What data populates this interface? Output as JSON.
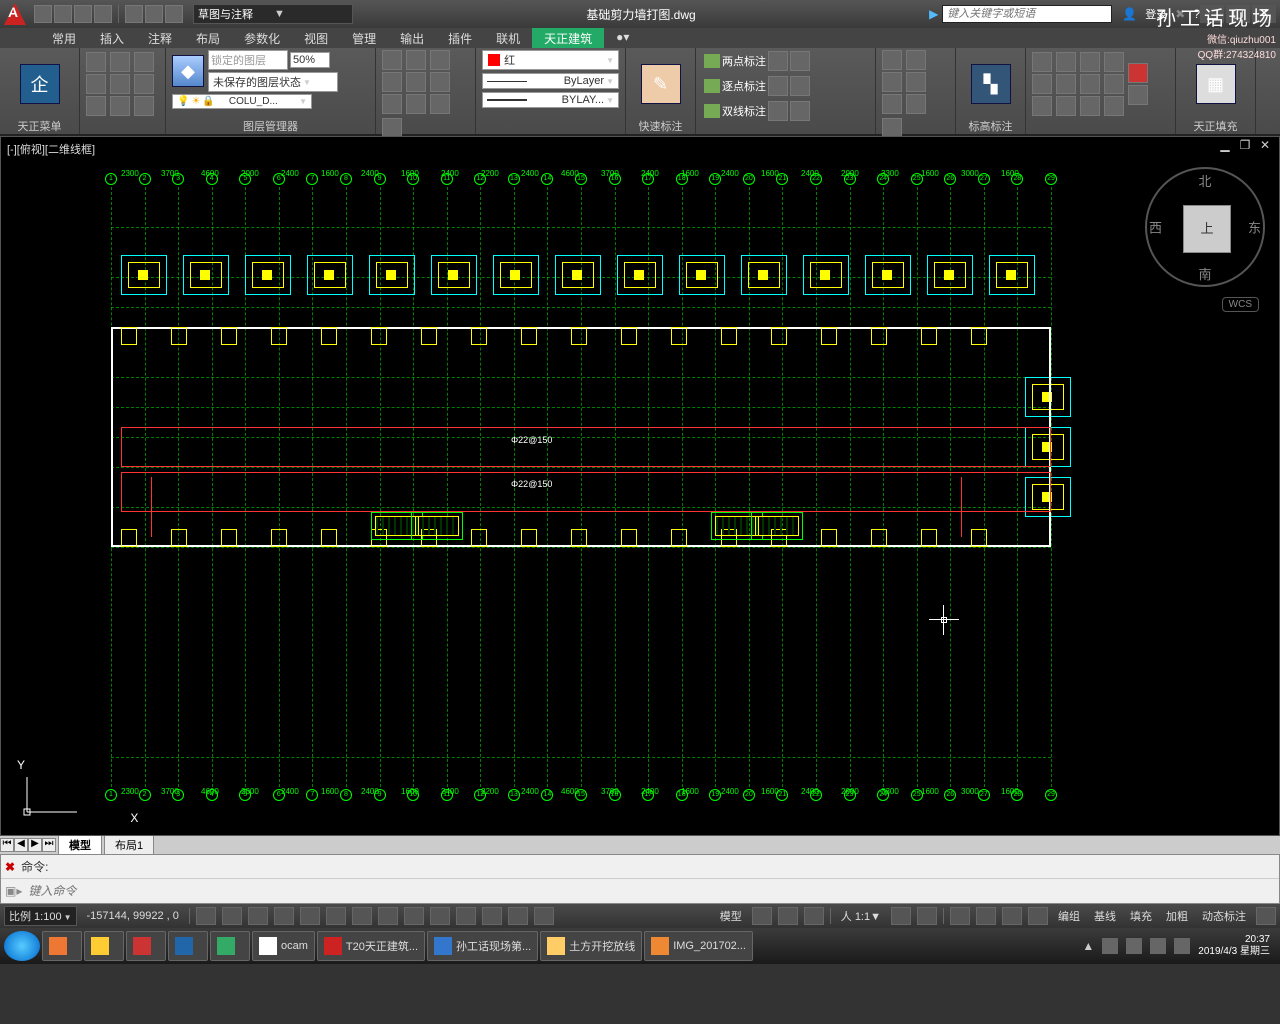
{
  "title": {
    "workspace": "草图与注释",
    "filename": "基础剪力墙打图.dwg",
    "search_placeholder": "键入关键字或短语",
    "login": "登录"
  },
  "watermark": {
    "line1": "孙工话现场",
    "line2": "微信:qiuzhu001",
    "line3": "QQ群:274324810"
  },
  "tabs": [
    "常用",
    "插入",
    "注释",
    "布局",
    "参数化",
    "视图",
    "管理",
    "输出",
    "插件",
    "联机",
    "天正建筑"
  ],
  "ribbon": {
    "p1_title": "天正菜单",
    "p2_title": "图层管理器",
    "p2_locked": "锁定的图层",
    "p2_pct": "50%",
    "p2_layerstate": "未保存的图层状态",
    "p2_layer": "COLU_D...",
    "p3_color": "红",
    "p3_lt": "ByLayer",
    "p3_lw": "BYLAY...",
    "p4_title": "快速标注",
    "p4_d1": "两点标注",
    "p4_d2": "逐点标注",
    "p4_d3": "双线标注",
    "p5_title": "标高标注",
    "p6_title": "天正填充"
  },
  "viewport": {
    "label": "[-][俯视][二维线框]",
    "compass": {
      "n": "北",
      "s": "南",
      "e": "东",
      "w": "西",
      "top": "上"
    },
    "wcs": "WCS",
    "ucs_x": "X",
    "ucs_y": "Y",
    "grid_nums": [
      "1",
      "2",
      "3",
      "4",
      "5",
      "6",
      "7",
      "8",
      "9",
      "10",
      "11",
      "12",
      "13",
      "14",
      "15",
      "16",
      "17",
      "18",
      "19",
      "20",
      "21",
      "22",
      "23",
      "24",
      "25",
      "26",
      "27",
      "28",
      "29"
    ],
    "dims_top": [
      "2300",
      "3700",
      "4600",
      "2000",
      "2400",
      "1600",
      "2400",
      "1600",
      "2400",
      "2200",
      "2400",
      "4600",
      "3700",
      "2400",
      "1600",
      "2400",
      "1600",
      "2400",
      "2000",
      "3300",
      "1600",
      "3000",
      "1600"
    ],
    "anno1": "Φ22@150",
    "anno2": "Φ22@150"
  },
  "layout_tabs": {
    "model": "模型",
    "layout1": "布局1"
  },
  "cmd": {
    "label": "命令:",
    "prompt_placeholder": "键入命令"
  },
  "status": {
    "scale": "比例 1:100",
    "coords": "-157144, 99922 , 0",
    "right": [
      "模型",
      "编组",
      "基线",
      "填充",
      "加粗",
      "动态标注"
    ],
    "angle": "1:1",
    "ratio": "人"
  },
  "taskbar": {
    "items": [
      "",
      "",
      "",
      "",
      "",
      "ocam",
      "T20天正建筑...",
      "孙工话现场第...",
      "土方开挖放线",
      "IMG_201702..."
    ],
    "time": "20:37",
    "date": "2019/4/3 星期三"
  },
  "colors": {
    "accent": "#2a6"
  }
}
